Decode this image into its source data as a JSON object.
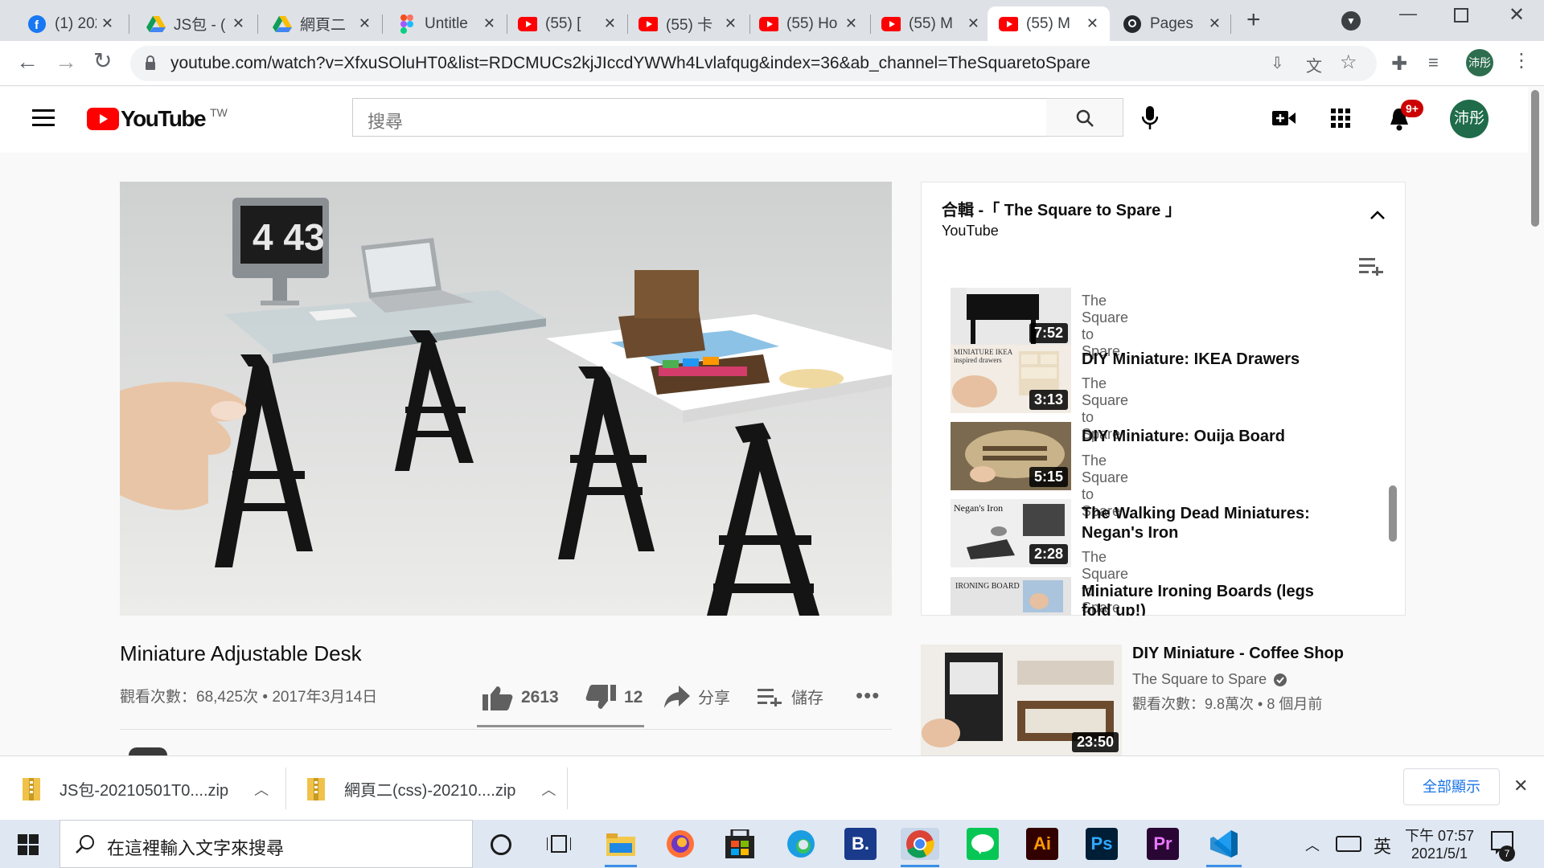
{
  "tabs": [
    {
      "label": "(1) 202",
      "icon": "facebook-icon"
    },
    {
      "label": "JS包 - (",
      "icon": "google-drive-icon"
    },
    {
      "label": "網頁二",
      "icon": "google-drive-icon"
    },
    {
      "label": "Untitle",
      "icon": "figma-icon"
    },
    {
      "label": "(55) [",
      "icon": "youtube-icon"
    },
    {
      "label": "(55) 卡",
      "icon": "youtube-icon"
    },
    {
      "label": "(55) Ho",
      "icon": "youtube-icon"
    },
    {
      "label": "(55) M",
      "icon": "youtube-icon"
    },
    {
      "label": "(55) M",
      "icon": "youtube-icon"
    },
    {
      "label": "Pages",
      "icon": "github-icon"
    }
  ],
  "address": {
    "url": "youtube.com/watch?v=XfxuSOluHT0&list=RDCMUCs2kjJIccdYWWh4Lvlafqug&index=36&ab_channel=TheSquaretoSpare"
  },
  "profile_initials": "沛彤",
  "yt": {
    "logo_text": "YouTube",
    "region": "TW",
    "search_placeholder": "搜尋",
    "notif_count": "9+"
  },
  "video": {
    "title": "Miniature Adjustable Desk",
    "stats": "觀看次數：68,425次 • 2017年3月14日",
    "likes": "2613",
    "dislikes": "12",
    "share": "分享",
    "save": "儲存",
    "clock_display": "4 43"
  },
  "playlist": {
    "title": "合輯 -「 The Square to Spare 」",
    "owner": "YouTube",
    "items": [
      {
        "title": "",
        "channel": "The Square to Spare",
        "duration": "7:52"
      },
      {
        "title": "DIY Miniature: IKEA Drawers",
        "channel": "The Square to Spare",
        "duration": "3:13",
        "thumb_text": "MINIATURE IKEA inspired drawers"
      },
      {
        "title": "DIY Miniature: Ouija Board",
        "channel": "The Square to Spare",
        "duration": "5:15"
      },
      {
        "title": "The Walking Dead Miniatures: Negan's Iron",
        "channel": "The Square to Spare",
        "duration": "2:28",
        "thumb_text": "Negan's Iron"
      },
      {
        "title": "Miniature Ironing Boards (legs fold up!)",
        "channel": "",
        "duration": "",
        "thumb_text": "IRONING BOARD"
      }
    ]
  },
  "related": {
    "title": "DIY Miniature - Coffee Shop",
    "channel": "The Square to Spare",
    "meta": "觀看次數：9.8萬次 • 8 個月前",
    "duration": "23:50"
  },
  "downloads": {
    "items": [
      "JS包-20210501T0....zip",
      "網頁二(css)-20210....zip"
    ],
    "show_all": "全部顯示"
  },
  "taskbar": {
    "search_placeholder": "在這裡輸入文字來搜尋",
    "ime": "英",
    "time": "下午 07:57",
    "date": "2021/5/1",
    "notification_count": "7"
  }
}
